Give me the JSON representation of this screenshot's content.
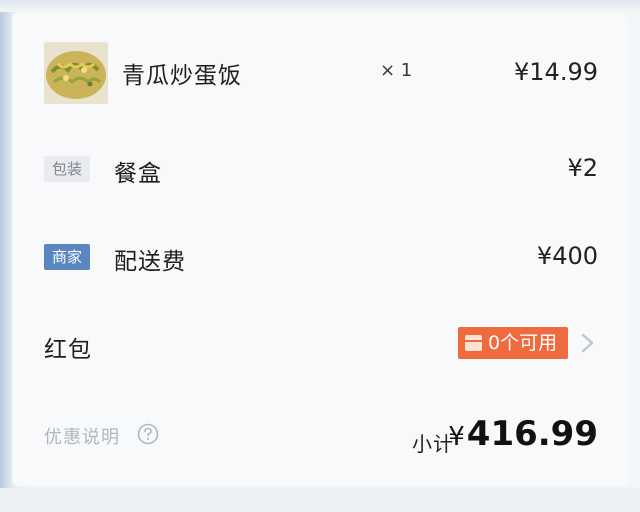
{
  "order": {
    "item": {
      "name": "青瓜炒蛋饭",
      "quantity": "× 1",
      "price": "¥14.99",
      "image_icon": "food-thumbnail"
    },
    "fees": [
      {
        "tag": "包装",
        "tag_style": "gray",
        "label": "餐盒",
        "price": "¥2"
      },
      {
        "tag": "商家",
        "tag_style": "blue",
        "label": "配送费",
        "price": "¥400"
      }
    ],
    "red_packet": {
      "label": "红包",
      "badge": "0个可用",
      "badge_color": "#ef6a3c"
    },
    "discount_note": "优惠说明",
    "subtotal": {
      "label": "小计",
      "currency": "¥",
      "amount": "416.99"
    }
  }
}
